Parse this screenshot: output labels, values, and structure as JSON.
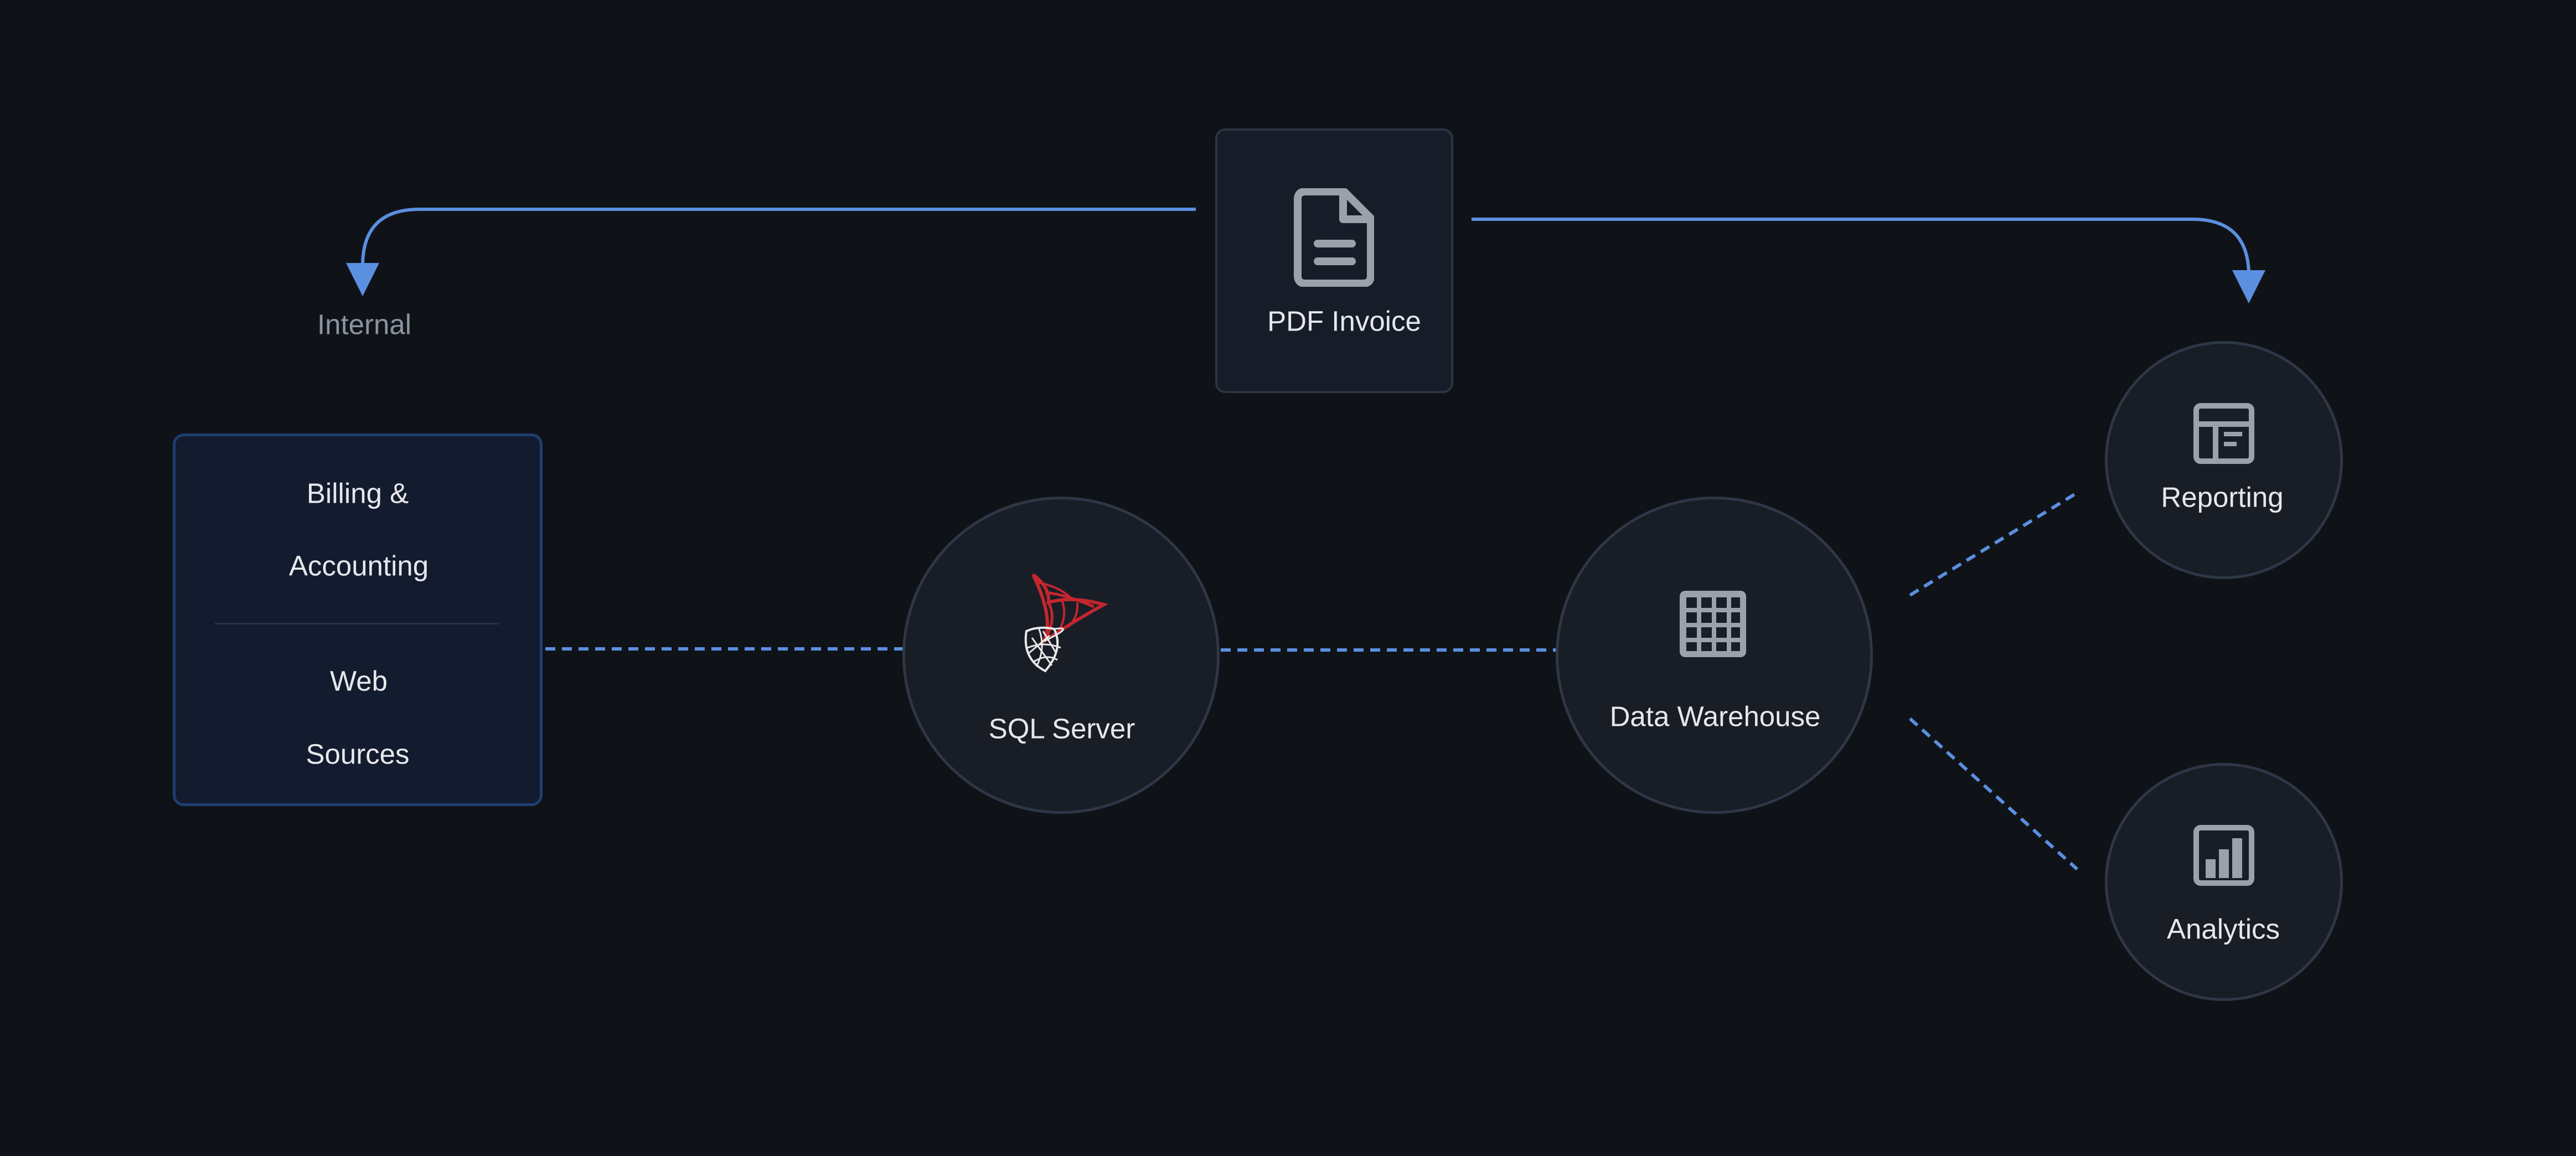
{
  "nodes": {
    "internal": "Internal",
    "pdf_invoice": "PDF Invoice",
    "sources": {
      "billing": [
        "Billing &",
        "Accounting"
      ],
      "web": [
        "Web",
        "Sources"
      ]
    },
    "sql_server": "SQL Server",
    "data_warehouse": "Data Warehouse",
    "reporting": "Reporting",
    "analytics": "Analytics"
  },
  "icons": {
    "pdf": "document-icon",
    "sql": "sql-server-logo-icon",
    "warehouse": "grid-icon",
    "reporting": "dashboard-layout-icon",
    "analytics": "bar-chart-icon"
  },
  "colors": {
    "background": "#0f1318",
    "connector": "#5b8fe0",
    "node_border": "#2f3746",
    "source_border": "#1f3f72",
    "icon": "#9aa1ab",
    "sql_red": "#c4262e"
  }
}
